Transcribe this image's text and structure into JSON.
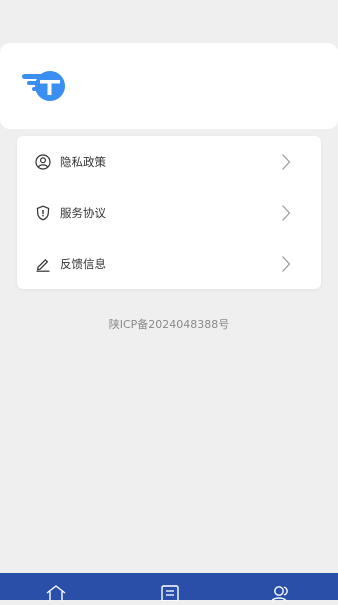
{
  "header": {
    "logo_icon": "brand-logo-icon",
    "brand_color": "#3b8ff0"
  },
  "menu": {
    "items": [
      {
        "label": "隐私政策",
        "icon": "user-circle-icon"
      },
      {
        "label": "服务协议",
        "icon": "shield-icon"
      },
      {
        "label": "反馈信息",
        "icon": "pencil-icon"
      }
    ]
  },
  "footer": {
    "icp": "陕ICP备2024048388号"
  },
  "tabbar": {
    "color": "#2a4fa8",
    "tabs": [
      {
        "icon": "home-icon"
      },
      {
        "icon": "document-icon"
      },
      {
        "icon": "users-icon"
      }
    ]
  }
}
